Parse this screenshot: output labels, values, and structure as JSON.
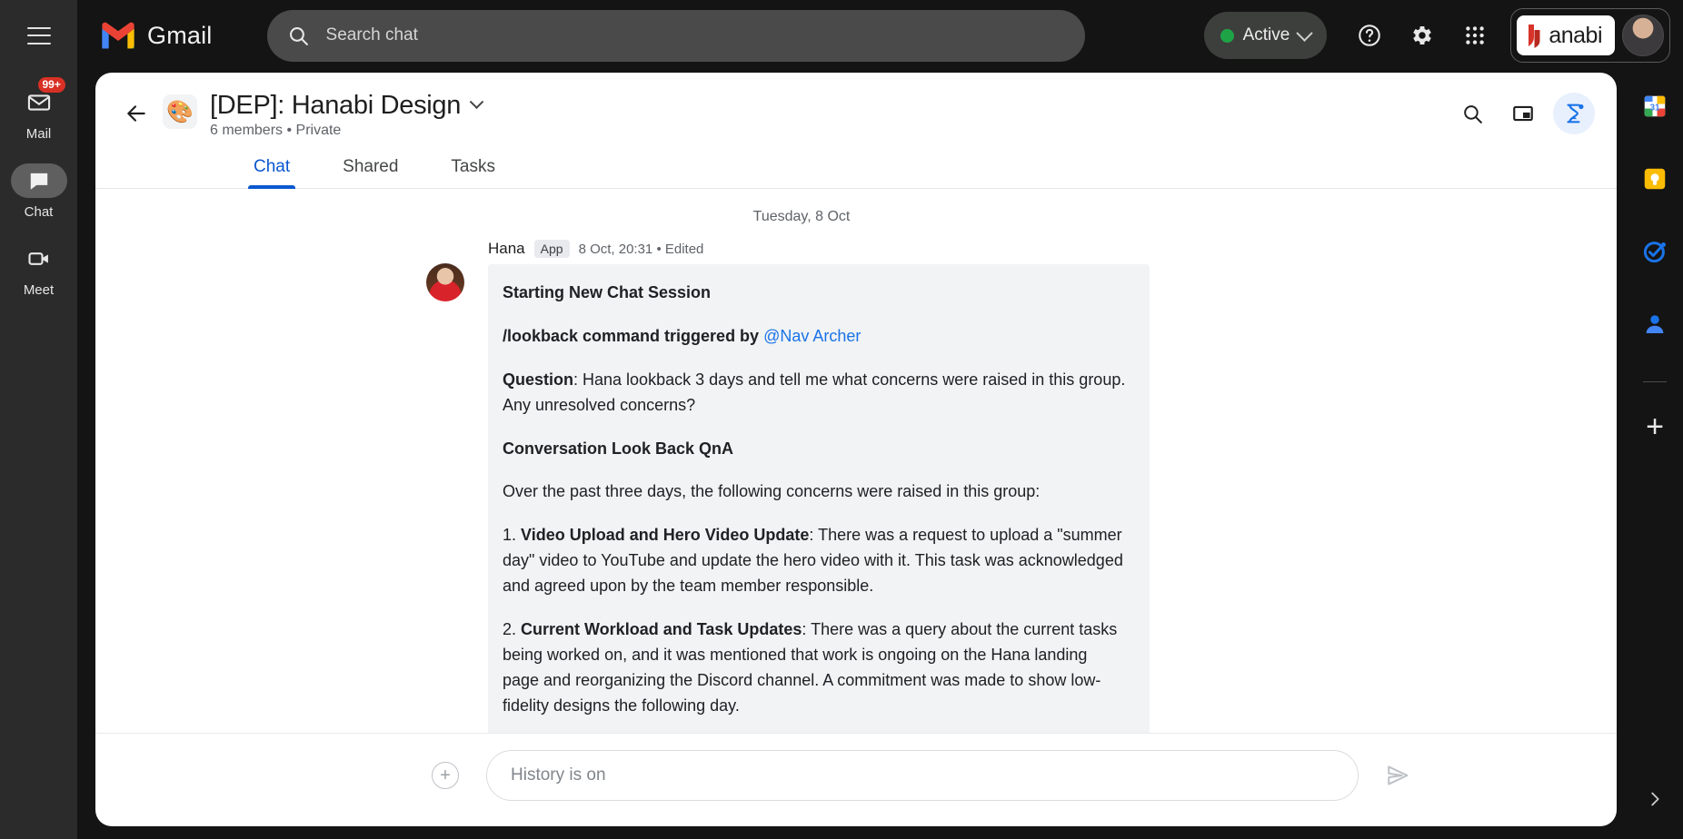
{
  "topbar": {
    "menu_icon": "hamburger-menu-icon",
    "brand": "Gmail",
    "search": {
      "placeholder": "Search chat",
      "value": "",
      "icon": "search-icon"
    },
    "status": {
      "label": "Active",
      "color": "#1ea446",
      "chevron": "chevron-down-icon"
    },
    "help_icon": "help-circle-icon",
    "settings_icon": "gear-icon",
    "apps_icon": "apps-grid-icon",
    "account": {
      "workspace": "anabi",
      "logo_color": "#d8342a",
      "avatar": "user-avatar"
    }
  },
  "left_rail": {
    "items": [
      {
        "label": "Mail",
        "icon": "mail-icon",
        "badge": "99+",
        "selected": false
      },
      {
        "label": "Chat",
        "icon": "chat-bubble-icon",
        "badge": "",
        "selected": true
      },
      {
        "label": "Meet",
        "icon": "video-camera-icon",
        "badge": "",
        "selected": false
      }
    ]
  },
  "right_rail": {
    "items": [
      {
        "name": "calendar-icon",
        "label": "31"
      },
      {
        "name": "keep-icon",
        "label": ""
      },
      {
        "name": "tasks-icon",
        "label": ""
      },
      {
        "name": "contacts-icon",
        "label": ""
      }
    ],
    "add_label": "+",
    "expand_icon": "chevron-right-icon"
  },
  "room": {
    "back_icon": "arrow-left-icon",
    "emoji": "🎨",
    "title": "[DEP]: Hanabi Design",
    "title_chevron": "chevron-down-icon",
    "subtitle": "6 members • Private",
    "actions": [
      {
        "name": "search-icon",
        "active": false
      },
      {
        "name": "picture-in-picture-icon",
        "active": false
      },
      {
        "name": "hana-assistant-icon",
        "active": true
      }
    ],
    "tabs": [
      {
        "label": "Chat",
        "active": true
      },
      {
        "label": "Shared",
        "active": false
      },
      {
        "label": "Tasks",
        "active": false
      }
    ]
  },
  "conversation": {
    "date_divider": "Tuesday, 8 Oct",
    "message": {
      "sender": "Hana",
      "sender_tag": "App",
      "timestamp": "8 Oct, 20:31 • Edited",
      "avatar": "hana-avatar",
      "heading": "Starting New Chat Session",
      "command_prefix": "/lookback command triggered by ",
      "command_mention": "@Nav Archer",
      "question_label": "Question",
      "question_text": ": Hana lookback 3 days and tell me what concerns were raised in this group. Any unresolved concerns?",
      "section_title": "Conversation Look Back QnA",
      "intro": "Over the past three days, the following concerns were raised in this group:",
      "items": [
        {
          "number": "1. ",
          "title": "Video Upload and Hero Video Update",
          "body": ": There was a request to upload a \"summer day\" video to YouTube and update the hero video with it. This task was acknowledged and agreed upon by the team member responsible."
        },
        {
          "number": "2. ",
          "title": "Current Workload and Task Updates",
          "body": ": There was a query about the current tasks being worked on, and it was mentioned that work is ongoing on the Hana landing page and reorganizing the Discord channel. A commitment was made to show low-fidelity designs the following day."
        }
      ]
    }
  },
  "composer": {
    "add_icon": "plus-circle-icon",
    "placeholder": "History is on",
    "value": "",
    "send_icon": "send-icon"
  }
}
